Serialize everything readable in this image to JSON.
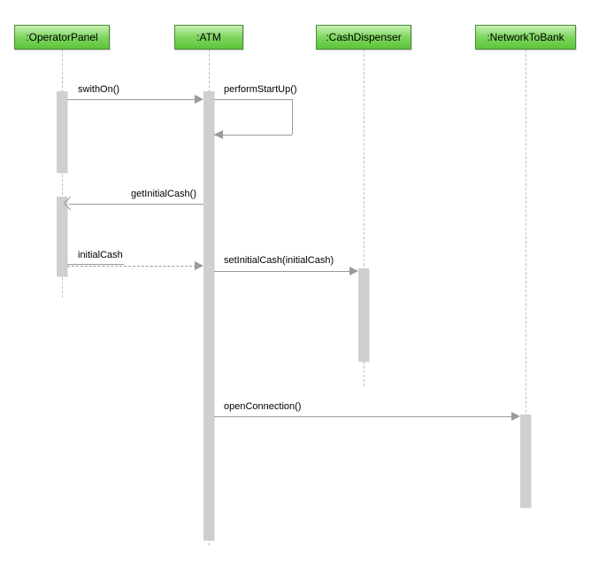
{
  "lifelines": {
    "operator": ":OperatorPanel",
    "atm": ":ATM",
    "dispenser": ":CashDispenser",
    "network": ":NetworkToBank"
  },
  "messages": {
    "m1": "swithOn()",
    "m2": "performStartUp()",
    "m3": "getInitialCash()",
    "m4": "initialCash",
    "m5": "setInitialCash(initialCash)",
    "m6": "openConnection()"
  }
}
